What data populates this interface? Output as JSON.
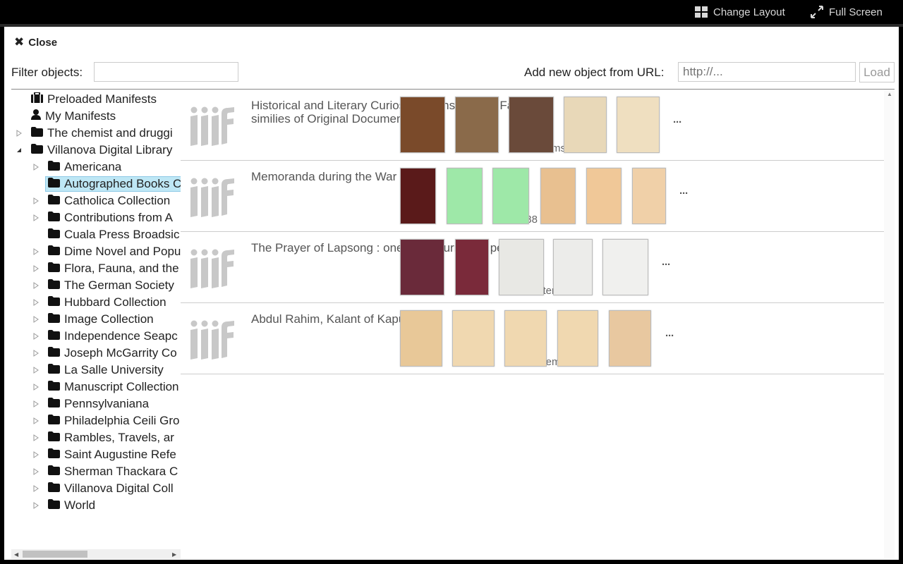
{
  "topbar": {
    "change_layout_label": "Change Layout",
    "full_screen_label": "Full Screen"
  },
  "panel": {
    "close_label": "Close",
    "filter_label": "Filter objects:",
    "filter_value": "",
    "url_label": "Add new object from URL:",
    "url_placeholder": "http://...",
    "load_label": "Load"
  },
  "tree": [
    {
      "label": "Preloaded Manifests",
      "icon": "briefcase-icon",
      "level": 1,
      "expander": "none"
    },
    {
      "label": "My Manifests",
      "icon": "user-icon",
      "level": 1,
      "expander": "none"
    },
    {
      "label": "The chemist and druggi",
      "icon": "folder-icon",
      "level": 1,
      "expander": "collapsed"
    },
    {
      "label": "Villanova Digital Library",
      "icon": "folder-icon",
      "level": 1,
      "expander": "expanded"
    },
    {
      "label": "Americana",
      "icon": "folder-icon",
      "level": 2,
      "expander": "collapsed"
    },
    {
      "label": "Autographed Books C",
      "icon": "folder-icon",
      "level": 2,
      "expander": "none",
      "selected": true
    },
    {
      "label": "Catholica Collection",
      "icon": "folder-icon",
      "level": 2,
      "expander": "collapsed"
    },
    {
      "label": "Contributions from A",
      "icon": "folder-icon",
      "level": 2,
      "expander": "collapsed"
    },
    {
      "label": "Cuala Press Broadsic",
      "icon": "folder-icon",
      "level": 2,
      "expander": "none"
    },
    {
      "label": "Dime Novel and Popu",
      "icon": "folder-icon",
      "level": 2,
      "expander": "collapsed"
    },
    {
      "label": "Flora, Fauna, and the",
      "icon": "folder-icon",
      "level": 2,
      "expander": "collapsed"
    },
    {
      "label": "The German Society",
      "icon": "folder-icon",
      "level": 2,
      "expander": "collapsed"
    },
    {
      "label": "Hubbard Collection",
      "icon": "folder-icon",
      "level": 2,
      "expander": "collapsed"
    },
    {
      "label": "Image Collection",
      "icon": "folder-icon",
      "level": 2,
      "expander": "collapsed"
    },
    {
      "label": "Independence Seapc",
      "icon": "folder-icon",
      "level": 2,
      "expander": "collapsed"
    },
    {
      "label": "Joseph McGarrity Co",
      "icon": "folder-icon",
      "level": 2,
      "expander": "collapsed"
    },
    {
      "label": "La Salle University",
      "icon": "folder-icon",
      "level": 2,
      "expander": "collapsed"
    },
    {
      "label": "Manuscript Collection",
      "icon": "folder-icon",
      "level": 2,
      "expander": "collapsed"
    },
    {
      "label": "Pennsylvaniana",
      "icon": "folder-icon",
      "level": 2,
      "expander": "collapsed"
    },
    {
      "label": "Philadelphia Ceili Gro",
      "icon": "folder-icon",
      "level": 2,
      "expander": "collapsed"
    },
    {
      "label": "Rambles, Travels, ar",
      "icon": "folder-icon",
      "level": 2,
      "expander": "collapsed"
    },
    {
      "label": "Saint Augustine Refe",
      "icon": "folder-icon",
      "level": 2,
      "expander": "collapsed"
    },
    {
      "label": "Sherman Thackara C",
      "icon": "folder-icon",
      "level": 2,
      "expander": "collapsed"
    },
    {
      "label": "Villanova Digital Coll",
      "icon": "folder-icon",
      "level": 2,
      "expander": "collapsed"
    },
    {
      "label": "World",
      "icon": "folder-icon",
      "level": 2,
      "expander": "collapsed"
    }
  ],
  "objects": [
    {
      "title": "Historical and Literary Curiosities consisting of Fac-similies of Original Documents",
      "count": "331 items",
      "thumbs": [
        "#7a4a2a",
        "#8a6a4a",
        "#6a4a3a",
        "#e8d8b8",
        "#efdfc0"
      ]
    },
    {
      "title": "Memoranda during the War",
      "count": "88 items",
      "thumbs": [
        "#5a1a1a",
        "#9ee8a8",
        "#9ee8a8",
        "#e8c090",
        "#f0c898",
        "#f0d0a8"
      ]
    },
    {
      "title": "The Prayer of Lapsong : one cat's journey to peace",
      "count": "58 items",
      "thumbs": [
        "#6a2a3a",
        "#7a2a3a",
        "#e8e8e4",
        "#ececea",
        "#f0f0ee"
      ]
    },
    {
      "title": "Abdul Rahim, Kalant of Kapurthala",
      "count": "42 items",
      "thumbs": [
        "#e8c898",
        "#f0d8b0",
        "#f0d8b0",
        "#f0d8b0",
        "#e8c8a0"
      ]
    }
  ],
  "more_label": "···",
  "iiif_logo_text": "iiif",
  "colors": {
    "selected_bg": "#bee7f5",
    "logo_gray": "#c8c8c8"
  }
}
